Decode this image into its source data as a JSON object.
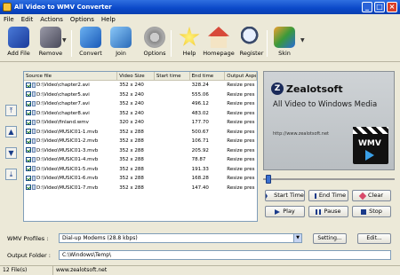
{
  "window": {
    "title": "All Video to WMV Converter"
  },
  "menu": [
    "File",
    "Edit",
    "Actions",
    "Options",
    "Help"
  ],
  "toolbar": [
    {
      "label": "Add File",
      "icon": "add-file-icon"
    },
    {
      "label": "Remove",
      "icon": "remove-icon"
    },
    {
      "label": "Convert",
      "icon": "convert-icon"
    },
    {
      "label": "Join",
      "icon": "join-icon"
    },
    {
      "label": "Options",
      "icon": "options-gear-icon"
    },
    {
      "label": "Help",
      "icon": "help-star-icon"
    },
    {
      "label": "Homepage",
      "icon": "homepage-house-icon"
    },
    {
      "label": "Register",
      "icon": "register-magnifier-icon"
    },
    {
      "label": "Skin",
      "icon": "skin-icon"
    }
  ],
  "columns": [
    "Source file",
    "Video Size",
    "Start time",
    "End time",
    "Output Aspe"
  ],
  "files": [
    {
      "name": "D:\\Video\\chapter2.avi",
      "size": "352 x 240",
      "start": "",
      "end": "328.24",
      "aspect": "Resize pres"
    },
    {
      "name": "D:\\Video\\chapter5.avi",
      "size": "352 x 240",
      "start": "",
      "end": "555.06",
      "aspect": "Resize pres"
    },
    {
      "name": "D:\\Video\\chapter7.avi",
      "size": "352 x 240",
      "start": "",
      "end": "496.12",
      "aspect": "Resize pres"
    },
    {
      "name": "D:\\Video\\chapter8.avi",
      "size": "352 x 240",
      "start": "",
      "end": "483.02",
      "aspect": "Resize pres"
    },
    {
      "name": "D:\\Video\\finland.wmv",
      "size": "320 x 240",
      "start": "",
      "end": "177.70",
      "aspect": "Resize pres"
    },
    {
      "name": "D:\\Video\\MUSIC01-1.mvb",
      "size": "352 x 288",
      "start": "",
      "end": "500.67",
      "aspect": "Resize pres"
    },
    {
      "name": "D:\\Video\\MUSIC01-2.mvb",
      "size": "352 x 288",
      "start": "",
      "end": "106.71",
      "aspect": "Resize pres"
    },
    {
      "name": "D:\\Video\\MUSIC01-3.mvb",
      "size": "352 x 288",
      "start": "",
      "end": "205.92",
      "aspect": "Resize pres"
    },
    {
      "name": "D:\\Video\\MUSIC01-4.mvb",
      "size": "352 x 288",
      "start": "",
      "end": "78.87",
      "aspect": "Resize pres"
    },
    {
      "name": "D:\\Video\\MUSIC01-5.mvb",
      "size": "352 x 288",
      "start": "",
      "end": "191.33",
      "aspect": "Resize pres"
    },
    {
      "name": "D:\\Video\\MUSIC01-6.mvb",
      "size": "352 x 288",
      "start": "",
      "end": "168.28",
      "aspect": "Resize pres"
    },
    {
      "name": "D:\\Video\\MUSIC01-7.mvb",
      "size": "352 x 288",
      "start": "",
      "end": "147.40",
      "aspect": "Resize pres"
    }
  ],
  "preview": {
    "brand": "Zealotsoft",
    "title": "All Video to Windows Media",
    "url": "http://www.zealotsoft.net",
    "badge": "WMV"
  },
  "controls": {
    "start_time": "Start Time",
    "end_time": "End Time",
    "clear": "Clear",
    "play": "Play",
    "pause": "Pause",
    "stop": "Stop"
  },
  "settings": {
    "profiles_label": "WMV Profiles :",
    "profile_value": "Dial-up Modems (28.8 kbps)",
    "setting_button": "Setting...",
    "output_label": "Output Folder :",
    "output_value": "C:\\Windows\\Temp\\",
    "edit_button": "Edit..."
  },
  "status": {
    "count": "12 File(s)",
    "url": "www.zealotsoft.net"
  }
}
